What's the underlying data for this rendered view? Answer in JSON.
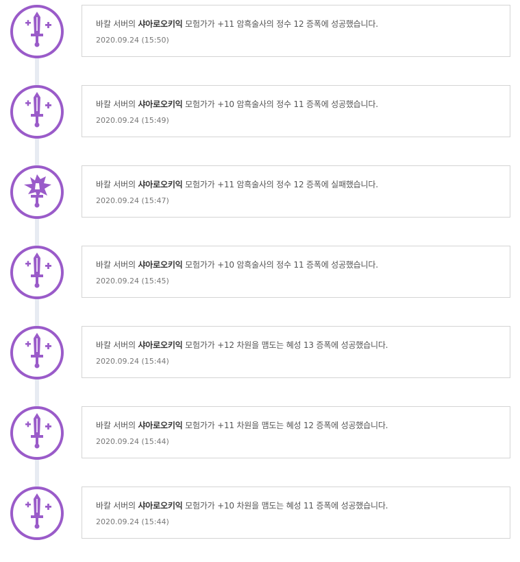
{
  "accent_color": "#9a5bc9",
  "entries": [
    {
      "server": "바칼 서버의",
      "character": "샤아로오키익",
      "rest": "모험가가 +11 암흑술사의 정수 12 증폭에 성공했습니다.",
      "time": "2020.09.24 (15:50)",
      "icon": "success-sword-icon"
    },
    {
      "server": "바칼 서버의",
      "character": "샤아로오키익",
      "rest": "모험가가 +10 암흑술사의 정수 11 증폭에 성공했습니다.",
      "time": "2020.09.24 (15:49)",
      "icon": "success-sword-icon"
    },
    {
      "server": "바칼 서버의",
      "character": "샤아로오키익",
      "rest": "모험가가 +11 암흑술사의 정수 12 증폭에 실패했습니다.",
      "time": "2020.09.24 (15:47)",
      "icon": "broken-sword-icon"
    },
    {
      "server": "바칼 서버의",
      "character": "샤아로오키익",
      "rest": "모험가가 +10 암흑술사의 정수 11 증폭에 성공했습니다.",
      "time": "2020.09.24 (15:45)",
      "icon": "success-sword-icon"
    },
    {
      "server": "바칼 서버의",
      "character": "샤아로오키익",
      "rest": "모험가가 +12 차원을 맴도는 혜성 13 증폭에 성공했습니다.",
      "time": "2020.09.24 (15:44)",
      "icon": "success-sword-icon"
    },
    {
      "server": "바칼 서버의",
      "character": "샤아로오키익",
      "rest": "모험가가 +11 차원을 맴도는 혜성 12 증폭에 성공했습니다.",
      "time": "2020.09.24 (15:44)",
      "icon": "success-sword-icon"
    },
    {
      "server": "바칼 서버의",
      "character": "샤아로오키익",
      "rest": "모험가가 +10 차원을 맴도는 혜성 11 증폭에 성공했습니다.",
      "time": "2020.09.24 (15:44)",
      "icon": "success-sword-icon"
    }
  ]
}
